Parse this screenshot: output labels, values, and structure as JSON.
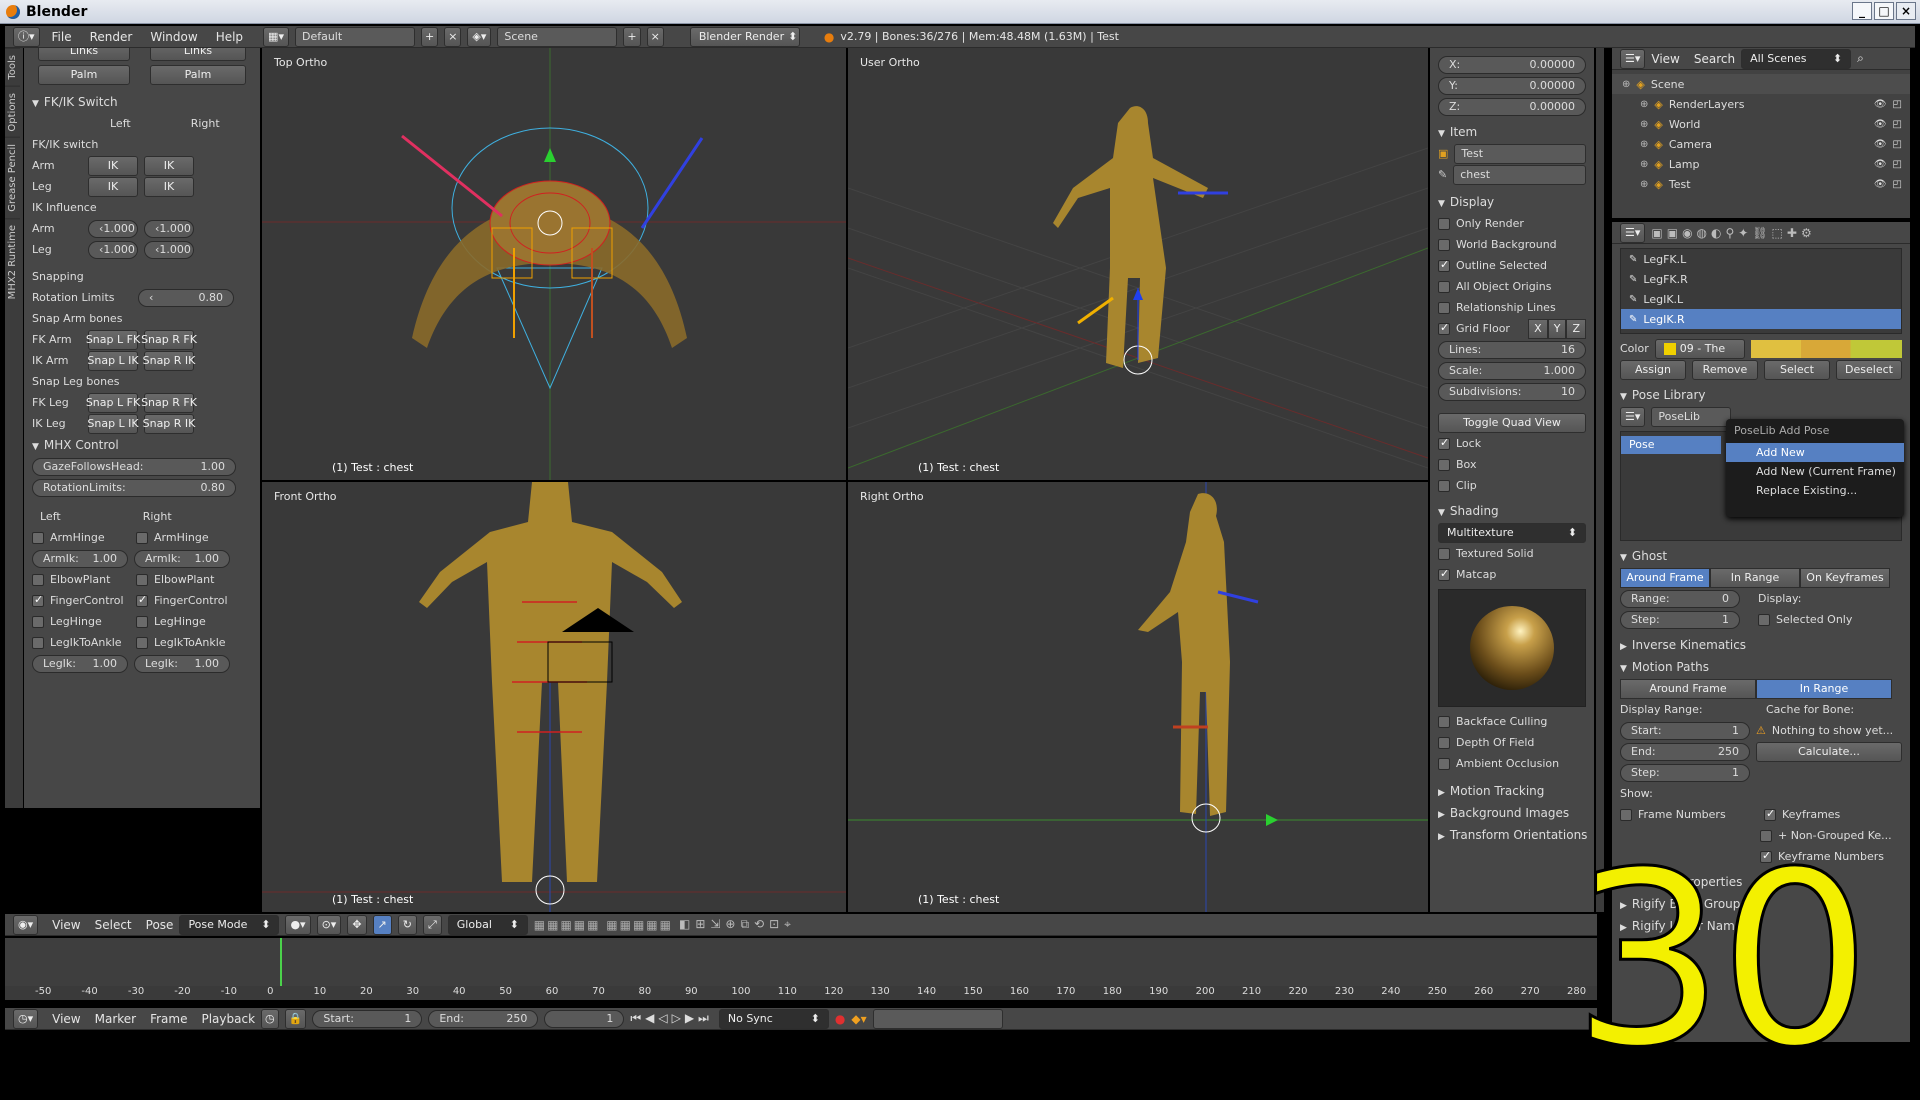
{
  "window": {
    "title": "Blender"
  },
  "menubar": {
    "menus": [
      "File",
      "Render",
      "Window",
      "Help"
    ],
    "layout": "Default",
    "scene": "Scene",
    "engine": "Blender Render",
    "info": "v2.79 | Bones:36/276 | Mem:48.48M (1.63M) | Test"
  },
  "left_panel": {
    "tabs": [
      "Tools",
      "Options",
      "Grease Pencil",
      "MHX2 Runtime"
    ],
    "top_buttons": [
      "Links",
      "Links",
      "Palm",
      "Palm"
    ],
    "fkik": {
      "title": "FK/IK Switch",
      "col_left": "Left",
      "col_right": "Right",
      "fkik_switch": "FK/IK switch",
      "rows": [
        {
          "label": "Arm",
          "left": "IK",
          "right": "IK"
        },
        {
          "label": "Leg",
          "left": "IK",
          "right": "IK"
        }
      ],
      "ik_influence": "IK Influence",
      "influence": [
        {
          "label": "Arm",
          "left": "1.000",
          "right": "1.000"
        },
        {
          "label": "Leg",
          "left": "1.000",
          "right": "1.000"
        }
      ],
      "snapping": "Snapping",
      "rotation_limits_label": "Rotation Limits",
      "rotation_limits": "0.80",
      "snap_arm": "Snap Arm bones",
      "snap_arm_rows": [
        {
          "label": "FK Arm",
          "l": "Snap L FK",
          "r": "Snap R FK"
        },
        {
          "label": "IK Arm",
          "l": "Snap L IK",
          "r": "Snap R IK"
        }
      ],
      "snap_leg": "Snap Leg bones",
      "snap_leg_rows": [
        {
          "label": "FK Leg",
          "l": "Snap L FK",
          "r": "Snap R FK"
        },
        {
          "label": "IK Leg",
          "l": "Snap L IK",
          "r": "Snap R IK"
        }
      ]
    },
    "mhx": {
      "title": "MHX Control",
      "gaze_label": "GazeFollowsHead:",
      "gaze": "1.00",
      "rot_label": "RotationLimits:",
      "rot": "0.80",
      "col_left": "Left",
      "col_right": "Right",
      "checks": [
        {
          "l": "ArmHinge",
          "r": "ArmHinge",
          "type": "cb",
          "on": false
        },
        {
          "l": "ArmIk:",
          "r": "ArmIk:",
          "type": "num",
          "lv": "1.00",
          "rv": "1.00"
        },
        {
          "l": "ElbowPlant",
          "r": "ElbowPlant",
          "type": "cb",
          "on": false
        },
        {
          "l": "FingerControl",
          "r": "FingerControl",
          "type": "cb",
          "on": true
        },
        {
          "l": "LegHinge",
          "r": "LegHinge",
          "type": "cb",
          "on": false
        },
        {
          "l": "LegIkToAnkle",
          "r": "LegIkToAnkle",
          "type": "cb",
          "on": false
        },
        {
          "l": "LegIk:",
          "r": "LegIk:",
          "type": "num",
          "lv": "1.00",
          "rv": "1.00"
        }
      ]
    }
  },
  "viewports": {
    "top": "Top Ortho",
    "user": "User Ortho",
    "front": "Front Ortho",
    "right": "Right Ortho",
    "footer": "(1) Test : chest"
  },
  "viewport_header": {
    "menus": [
      "View",
      "Select",
      "Pose"
    ],
    "mode": "Pose Mode",
    "orientation": "Global"
  },
  "npanel": {
    "coords": [
      {
        "k": "X:",
        "v": "0.00000"
      },
      {
        "k": "Y:",
        "v": "0.00000"
      },
      {
        "k": "Z:",
        "v": "0.00000"
      }
    ],
    "item_title": "Item",
    "object": "Test",
    "bone": "chest",
    "display_title": "Display",
    "display_checks": [
      {
        "l": "Only Render",
        "on": false
      },
      {
        "l": "World Background",
        "on": false
      },
      {
        "l": "Outline Selected",
        "on": true
      },
      {
        "l": "All Object Origins",
        "on": false
      },
      {
        "l": "Relationship Lines",
        "on": false
      }
    ],
    "grid_floor": "Grid Floor",
    "axes": [
      "X",
      "Y",
      "Z"
    ],
    "grid": [
      {
        "k": "Lines:",
        "v": "16"
      },
      {
        "k": "Scale:",
        "v": "1.000"
      },
      {
        "k": "Subdivisions:",
        "v": "10"
      }
    ],
    "toggle_quad": "Toggle Quad View",
    "quad_checks": [
      {
        "l": "Lock",
        "on": true
      },
      {
        "l": "Box",
        "on": false
      },
      {
        "l": "Clip",
        "on": false
      }
    ],
    "shading_title": "Shading",
    "shading_mode": "Multitexture",
    "shading_checks": [
      {
        "l": "Textured Solid",
        "on": false
      },
      {
        "l": "Matcap",
        "on": true
      }
    ],
    "more_checks": [
      {
        "l": "Backface Culling",
        "on": false
      },
      {
        "l": "Depth Of Field",
        "on": false
      },
      {
        "l": "Ambient Occlusion",
        "on": false
      }
    ],
    "collapsed": [
      "Motion Tracking",
      "Background Images",
      "Transform Orientations"
    ]
  },
  "outliner": {
    "menus": [
      "View",
      "Search"
    ],
    "filter": "All Scenes",
    "items": [
      {
        "name": "Scene",
        "indent": 0
      },
      {
        "name": "RenderLayers",
        "indent": 1
      },
      {
        "name": "World",
        "indent": 1
      },
      {
        "name": "Camera",
        "indent": 1
      },
      {
        "name": "Lamp",
        "indent": 1
      },
      {
        "name": "Test",
        "indent": 1
      }
    ]
  },
  "properties": {
    "bone_groups": [
      "LegFK.L",
      "LegFK.R",
      "LegIK.L",
      "LegIK.R"
    ],
    "color_label": "Color",
    "color_value": "09 - The",
    "group_buttons": [
      "Assign",
      "Remove",
      "Select",
      "Deselect"
    ],
    "poselib_title": "Pose Library",
    "poselib_name": "PoseLib",
    "pose_item": "Pose",
    "ghost_title": "Ghost",
    "ghost_tabs": [
      "Around Frame",
      "In Range",
      "On Keyframes"
    ],
    "range_label": "Range:",
    "range": "0",
    "step_label": "Step:",
    "step": "1",
    "display_label": "Display:",
    "selected_only": "Selected Only",
    "ik_title": "Inverse Kinematics",
    "motion_title": "Motion Paths",
    "motion_tabs": [
      "Around Frame",
      "In Range"
    ],
    "display_range": "Display Range:",
    "cache_label": "Cache for Bone:",
    "start_label": "Start:",
    "start": "1",
    "end_label": "End:",
    "end": "250",
    "mstep_label": "Step:",
    "mstep": "1",
    "nothing": "Nothing to show yet...",
    "calculate": "Calculate...",
    "show_label": "Show:",
    "frame_numbers": "Frame Numbers",
    "keyframes": "Keyframes",
    "plus_nonGrouped": "+ Non-Grouped Ke...",
    "keyframe_numbers": "Keyframe Numbers",
    "custom": "Custom Properties",
    "rigify": "Rigify Bone Groups",
    "rigify_layer": "Rigify Layer Names"
  },
  "poselib_menu": {
    "title": "PoseLib Add Pose",
    "items": [
      "Add New",
      "Add New (Current Frame)",
      "Replace Existing..."
    ]
  },
  "timeline": {
    "menus": [
      "View",
      "Marker",
      "Frame",
      "Playback"
    ],
    "start_label": "Start:",
    "start": "1",
    "end_label": "End:",
    "end": "250",
    "current": "1",
    "sync": "No Sync",
    "ticks": [
      "-50",
      "-40",
      "-30",
      "-20",
      "-10",
      "0",
      "10",
      "20",
      "30",
      "40",
      "50",
      "60",
      "70",
      "80",
      "90",
      "100",
      "110",
      "120",
      "130",
      "140",
      "150",
      "160",
      "170",
      "180",
      "190",
      "200",
      "210",
      "220",
      "230",
      "240",
      "250",
      "260",
      "270",
      "280"
    ]
  },
  "overlay": {
    "number": "30"
  }
}
